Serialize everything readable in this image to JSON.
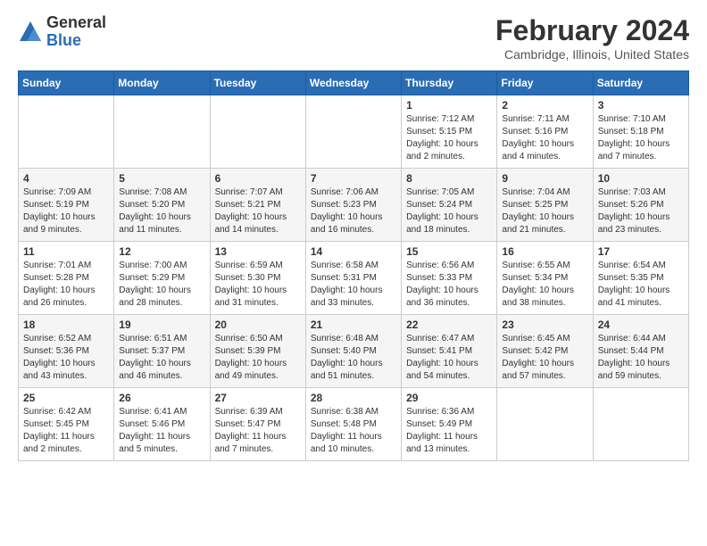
{
  "logo": {
    "general": "General",
    "blue": "Blue"
  },
  "title": "February 2024",
  "location": "Cambridge, Illinois, United States",
  "days_of_week": [
    "Sunday",
    "Monday",
    "Tuesday",
    "Wednesday",
    "Thursday",
    "Friday",
    "Saturday"
  ],
  "weeks": [
    [
      {
        "day": "",
        "info": ""
      },
      {
        "day": "",
        "info": ""
      },
      {
        "day": "",
        "info": ""
      },
      {
        "day": "",
        "info": ""
      },
      {
        "day": "1",
        "info": "Sunrise: 7:12 AM\nSunset: 5:15 PM\nDaylight: 10 hours\nand 2 minutes."
      },
      {
        "day": "2",
        "info": "Sunrise: 7:11 AM\nSunset: 5:16 PM\nDaylight: 10 hours\nand 4 minutes."
      },
      {
        "day": "3",
        "info": "Sunrise: 7:10 AM\nSunset: 5:18 PM\nDaylight: 10 hours\nand 7 minutes."
      }
    ],
    [
      {
        "day": "4",
        "info": "Sunrise: 7:09 AM\nSunset: 5:19 PM\nDaylight: 10 hours\nand 9 minutes."
      },
      {
        "day": "5",
        "info": "Sunrise: 7:08 AM\nSunset: 5:20 PM\nDaylight: 10 hours\nand 11 minutes."
      },
      {
        "day": "6",
        "info": "Sunrise: 7:07 AM\nSunset: 5:21 PM\nDaylight: 10 hours\nand 14 minutes."
      },
      {
        "day": "7",
        "info": "Sunrise: 7:06 AM\nSunset: 5:23 PM\nDaylight: 10 hours\nand 16 minutes."
      },
      {
        "day": "8",
        "info": "Sunrise: 7:05 AM\nSunset: 5:24 PM\nDaylight: 10 hours\nand 18 minutes."
      },
      {
        "day": "9",
        "info": "Sunrise: 7:04 AM\nSunset: 5:25 PM\nDaylight: 10 hours\nand 21 minutes."
      },
      {
        "day": "10",
        "info": "Sunrise: 7:03 AM\nSunset: 5:26 PM\nDaylight: 10 hours\nand 23 minutes."
      }
    ],
    [
      {
        "day": "11",
        "info": "Sunrise: 7:01 AM\nSunset: 5:28 PM\nDaylight: 10 hours\nand 26 minutes."
      },
      {
        "day": "12",
        "info": "Sunrise: 7:00 AM\nSunset: 5:29 PM\nDaylight: 10 hours\nand 28 minutes."
      },
      {
        "day": "13",
        "info": "Sunrise: 6:59 AM\nSunset: 5:30 PM\nDaylight: 10 hours\nand 31 minutes."
      },
      {
        "day": "14",
        "info": "Sunrise: 6:58 AM\nSunset: 5:31 PM\nDaylight: 10 hours\nand 33 minutes."
      },
      {
        "day": "15",
        "info": "Sunrise: 6:56 AM\nSunset: 5:33 PM\nDaylight: 10 hours\nand 36 minutes."
      },
      {
        "day": "16",
        "info": "Sunrise: 6:55 AM\nSunset: 5:34 PM\nDaylight: 10 hours\nand 38 minutes."
      },
      {
        "day": "17",
        "info": "Sunrise: 6:54 AM\nSunset: 5:35 PM\nDaylight: 10 hours\nand 41 minutes."
      }
    ],
    [
      {
        "day": "18",
        "info": "Sunrise: 6:52 AM\nSunset: 5:36 PM\nDaylight: 10 hours\nand 43 minutes."
      },
      {
        "day": "19",
        "info": "Sunrise: 6:51 AM\nSunset: 5:37 PM\nDaylight: 10 hours\nand 46 minutes."
      },
      {
        "day": "20",
        "info": "Sunrise: 6:50 AM\nSunset: 5:39 PM\nDaylight: 10 hours\nand 49 minutes."
      },
      {
        "day": "21",
        "info": "Sunrise: 6:48 AM\nSunset: 5:40 PM\nDaylight: 10 hours\nand 51 minutes."
      },
      {
        "day": "22",
        "info": "Sunrise: 6:47 AM\nSunset: 5:41 PM\nDaylight: 10 hours\nand 54 minutes."
      },
      {
        "day": "23",
        "info": "Sunrise: 6:45 AM\nSunset: 5:42 PM\nDaylight: 10 hours\nand 57 minutes."
      },
      {
        "day": "24",
        "info": "Sunrise: 6:44 AM\nSunset: 5:44 PM\nDaylight: 10 hours\nand 59 minutes."
      }
    ],
    [
      {
        "day": "25",
        "info": "Sunrise: 6:42 AM\nSunset: 5:45 PM\nDaylight: 11 hours\nand 2 minutes."
      },
      {
        "day": "26",
        "info": "Sunrise: 6:41 AM\nSunset: 5:46 PM\nDaylight: 11 hours\nand 5 minutes."
      },
      {
        "day": "27",
        "info": "Sunrise: 6:39 AM\nSunset: 5:47 PM\nDaylight: 11 hours\nand 7 minutes."
      },
      {
        "day": "28",
        "info": "Sunrise: 6:38 AM\nSunset: 5:48 PM\nDaylight: 11 hours\nand 10 minutes."
      },
      {
        "day": "29",
        "info": "Sunrise: 6:36 AM\nSunset: 5:49 PM\nDaylight: 11 hours\nand 13 minutes."
      },
      {
        "day": "",
        "info": ""
      },
      {
        "day": "",
        "info": ""
      }
    ]
  ]
}
